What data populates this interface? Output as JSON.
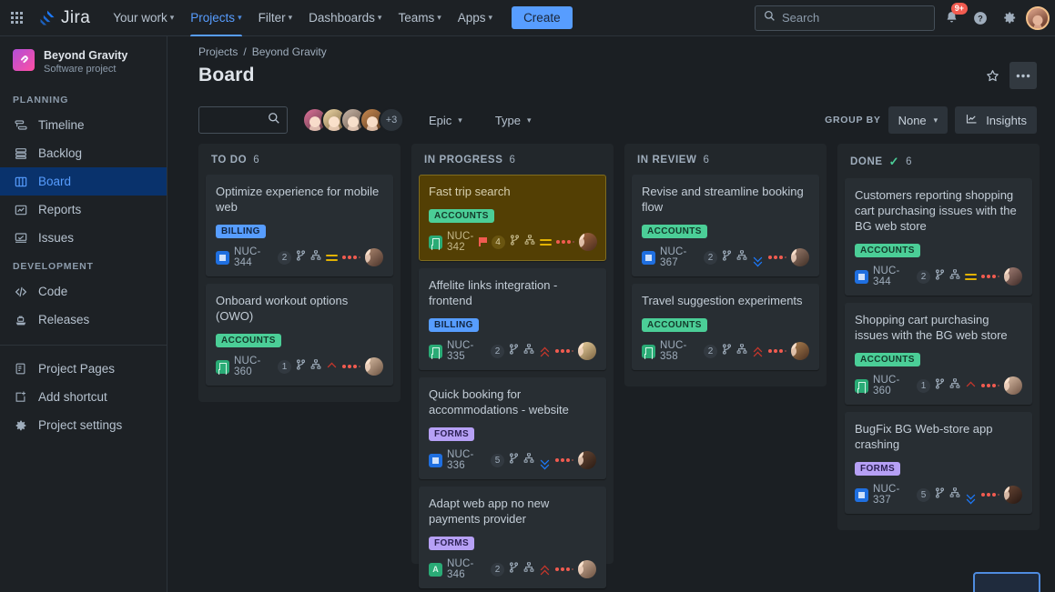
{
  "topnav": {
    "app_switcher": "app-switcher",
    "brand": "Jira",
    "links": [
      {
        "label": "Your work",
        "caret": true,
        "active": false
      },
      {
        "label": "Projects",
        "caret": true,
        "active": true
      },
      {
        "label": "Filter",
        "caret": true,
        "active": false
      },
      {
        "label": "Dashboards",
        "caret": true,
        "active": false
      },
      {
        "label": "Teams",
        "caret": true,
        "active": false
      },
      {
        "label": "Apps",
        "caret": true,
        "active": false
      }
    ],
    "create_label": "Create",
    "search_placeholder": "Search",
    "search_value": "",
    "notification_badge": "9+"
  },
  "sidebar": {
    "project_name": "Beyond Gravity",
    "project_type": "Software project",
    "project_icon": "rocket-icon",
    "sections": [
      {
        "label": "PLANNING",
        "items": [
          {
            "label": "Timeline",
            "icon": "timeline-icon",
            "selected": false
          },
          {
            "label": "Backlog",
            "icon": "backlog-icon",
            "selected": false
          },
          {
            "label": "Board",
            "icon": "board-icon",
            "selected": true
          },
          {
            "label": "Reports",
            "icon": "reports-icon",
            "selected": false
          },
          {
            "label": "Issues",
            "icon": "issues-icon",
            "selected": false
          }
        ]
      },
      {
        "label": "DEVELOPMENT",
        "items": [
          {
            "label": "Code",
            "icon": "code-icon",
            "selected": false
          },
          {
            "label": "Releases",
            "icon": "releases-icon",
            "selected": false
          }
        ]
      }
    ],
    "footer_items": [
      {
        "label": "Project Pages",
        "icon": "pages-icon"
      },
      {
        "label": "Add shortcut",
        "icon": "add-shortcut-icon"
      },
      {
        "label": "Project settings",
        "icon": "gear-icon"
      }
    ]
  },
  "header": {
    "breadcrumb": [
      "Projects",
      "Beyond Gravity"
    ],
    "breadcrumb_separator": "/",
    "title": "Board",
    "star_icon": "star-icon",
    "more_icon": "more-horizontal-icon"
  },
  "toolbar": {
    "search_value": "",
    "search_placeholder": "",
    "avatar_overflow": "+3",
    "filters": [
      {
        "label": "Epic"
      },
      {
        "label": "Type"
      }
    ],
    "group_by_label": "GROUP BY",
    "group_by_value": "None",
    "insights_label": "Insights"
  },
  "board": {
    "columns": [
      {
        "title": "TO DO",
        "count": "6",
        "done": false,
        "cards": [
          {
            "title": "Optimize experience for mobile web",
            "tag": "BILLING",
            "tag_class": "billing",
            "type": "story",
            "key": "NUC-344",
            "flag": false,
            "points": "2",
            "priority": "medium",
            "avatar": "#8b6f5a"
          },
          {
            "title": "Onboard workout options (OWO)",
            "tag": "ACCOUNTS",
            "tag_class": "accounts",
            "type": "task",
            "key": "NUC-360",
            "flag": false,
            "points": "1",
            "priority": "high",
            "avatar": "#c7a98f"
          }
        ]
      },
      {
        "title": "IN PROGRESS",
        "count": "6",
        "done": false,
        "cards": [
          {
            "title": "Fast trip search",
            "tag": "ACCOUNTS",
            "tag_class": "accounts",
            "type": "task",
            "key": "NUC-342",
            "flag": true,
            "points": "4",
            "priority": "medium",
            "highlight": true,
            "avatar": "#8a5a3a"
          },
          {
            "title": "Affelite links integration - frontend",
            "tag": "BILLING",
            "tag_class": "billing",
            "type": "task",
            "key": "NUC-335",
            "flag": false,
            "points": "2",
            "priority": "highest",
            "avatar": "#d9b27c"
          },
          {
            "title": "Quick booking for accommodations - website",
            "tag": "FORMS",
            "tag_class": "forms",
            "type": "story",
            "key": "NUC-336",
            "flag": false,
            "points": "5",
            "priority": "low",
            "avatar": "#5a4236"
          },
          {
            "title": "Adapt web app no new payments provider",
            "tag": "FORMS",
            "tag_class": "forms",
            "type": "a",
            "key": "NUC-346",
            "flag": false,
            "points": "2",
            "priority": "highest",
            "avatar": "#c0a089"
          }
        ]
      },
      {
        "title": "IN REVIEW",
        "count": "6",
        "done": false,
        "cards": [
          {
            "title": "Revise and streamline booking flow",
            "tag": "ACCOUNTS",
            "tag_class": "accounts",
            "type": "story",
            "key": "NUC-367",
            "flag": false,
            "points": "2",
            "priority": "low",
            "avatar": "#7d6150"
          },
          {
            "title": "Travel suggestion experiments",
            "tag": "ACCOUNTS",
            "tag_class": "accounts",
            "type": "task",
            "key": "NUC-358",
            "flag": false,
            "points": "2",
            "priority": "highest",
            "avatar": "#9d7552"
          }
        ]
      },
      {
        "title": "DONE",
        "count": "6",
        "done": true,
        "cards": [
          {
            "title": "Customers reporting shopping cart purchasing issues with the BG web store",
            "tag": "ACCOUNTS",
            "tag_class": "accounts",
            "type": "story",
            "key": "NUC-344",
            "flag": false,
            "points": "2",
            "priority": "medium",
            "avatar": "#8a6a58"
          },
          {
            "title": "Shopping cart purchasing issues with the BG web store",
            "tag": "ACCOUNTS",
            "tag_class": "accounts",
            "type": "task",
            "key": "NUC-360",
            "flag": false,
            "points": "1",
            "priority": "high",
            "avatar": "#c9a892"
          },
          {
            "title": "BugFix BG Web-store app crashing",
            "tag": "FORMS",
            "tag_class": "forms",
            "type": "story",
            "key": "NUC-337",
            "flag": false,
            "points": "5",
            "priority": "low",
            "avatar": "#55392c"
          }
        ]
      }
    ]
  },
  "colors": {
    "accent": "#579dff",
    "done": "#4bce97",
    "highlight_card": "#533f04",
    "danger": "#f15b50",
    "medium_priority": "#e2b203"
  }
}
